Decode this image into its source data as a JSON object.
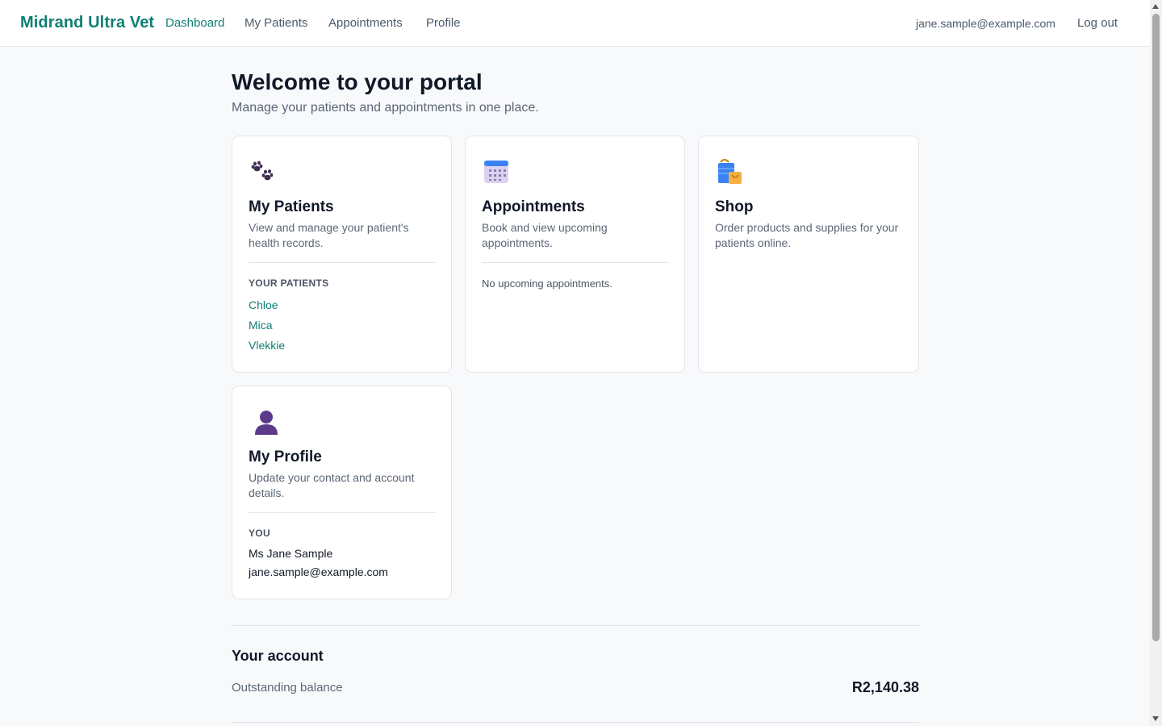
{
  "nav": {
    "brand": "Midrand Ultra Vet",
    "links": [
      "Dashboard",
      "My Patients",
      "Appointments",
      "Profile"
    ],
    "user_email": "jane.sample@example.com",
    "logout": "Log out"
  },
  "header": {
    "title": "Welcome to your portal",
    "subtitle": "Manage your patients and appointments in one place."
  },
  "cards": {
    "patients": {
      "icon": "paw-icon",
      "title": "My Patients",
      "description": "View and manage your patient's health records.",
      "section_label": "YOUR PATIENTS",
      "items": [
        "Chloe",
        "Mica",
        "Vlekkie"
      ]
    },
    "appointments": {
      "icon": "calendar-icon",
      "title": "Appointments",
      "description": "Book and view upcoming appointments.",
      "empty": "No upcoming appointments."
    },
    "shop": {
      "icon": "shopping-bag-icon",
      "title": "Shop",
      "description": "Order products and supplies for your patients online."
    },
    "profile": {
      "icon": "person-icon",
      "title": "My Profile",
      "description": "Update your contact and account details.",
      "section_label": "YOU",
      "name": "Ms Jane Sample",
      "email": "jane.sample@example.com"
    }
  },
  "account": {
    "heading": "Your account",
    "balance_label": "Outstanding balance",
    "balance_value": "R2,140.38"
  },
  "colors": {
    "accent": "#0f7f73",
    "muted_text": "#5b6776",
    "border": "#e2e5ea",
    "background": "#f8f9fb"
  }
}
